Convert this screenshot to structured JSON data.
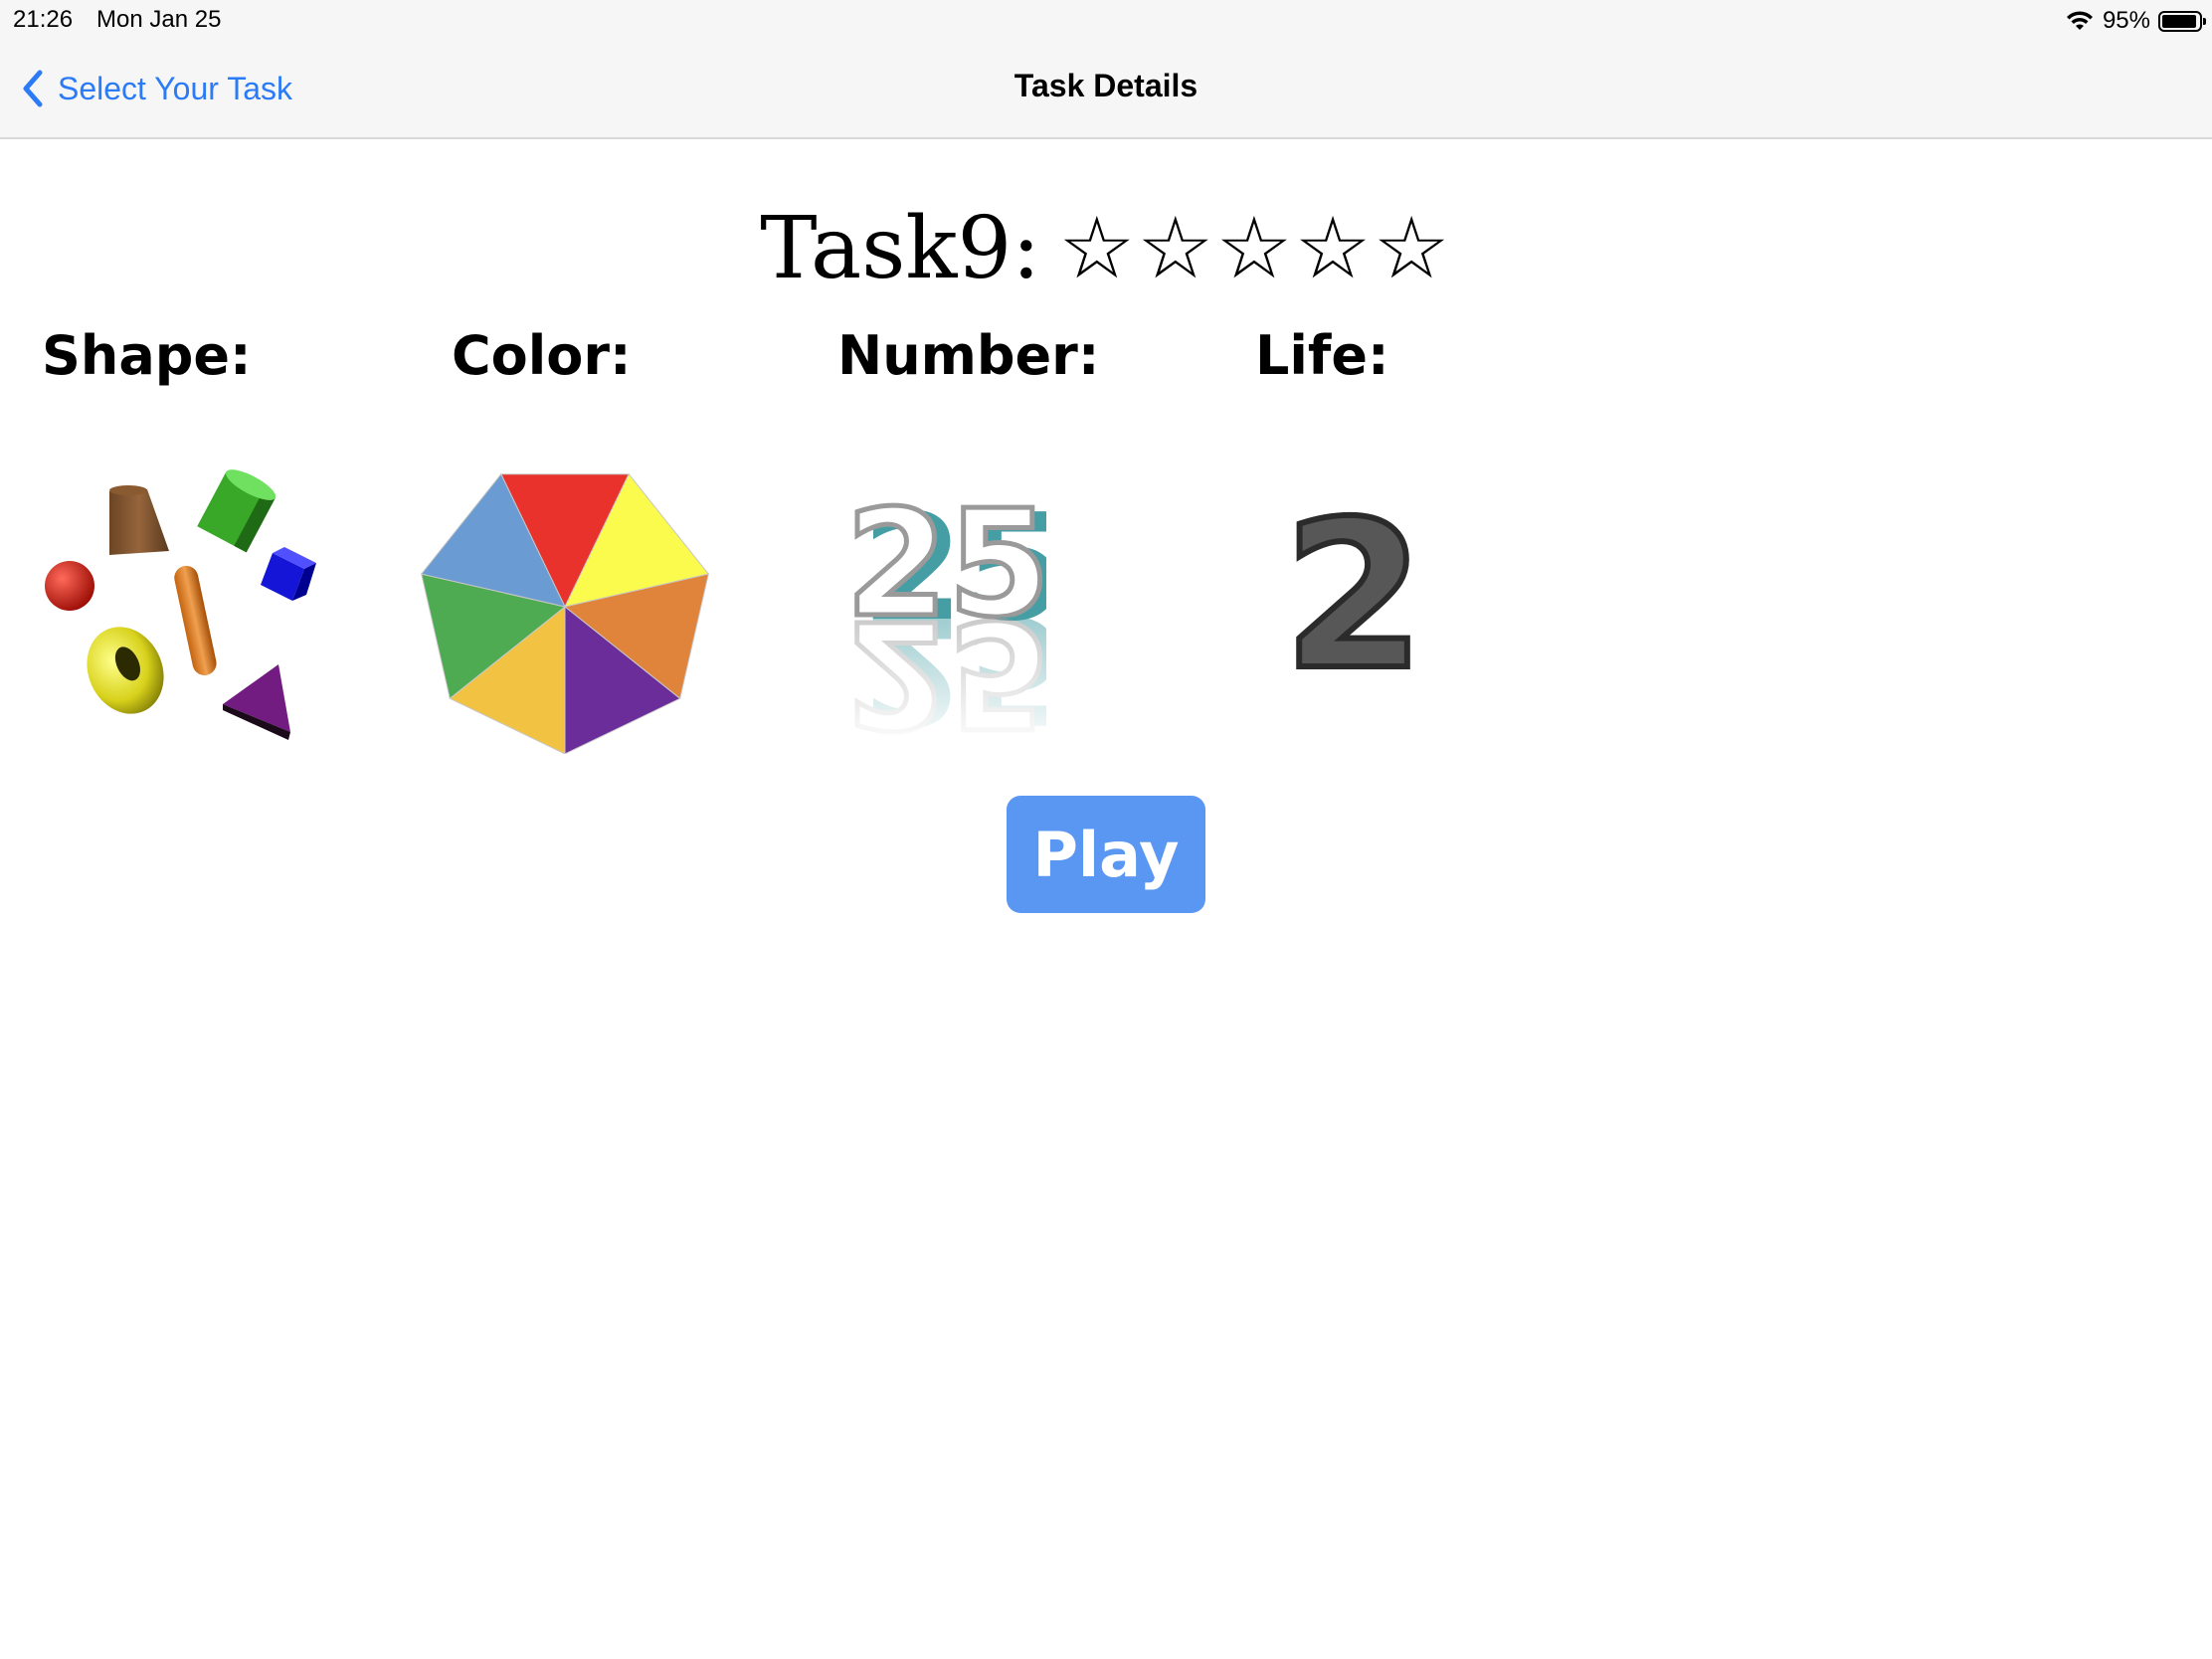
{
  "status_bar": {
    "time": "21:26",
    "date": "Mon Jan 25",
    "battery": "95%",
    "battery_level": 0.95
  },
  "nav": {
    "back_label": "Select Your Task",
    "title": "Task Details"
  },
  "task": {
    "name": "Task9:",
    "stars": "☆☆☆☆☆",
    "rating": 0,
    "max_rating": 5
  },
  "labels": {
    "shape": "Shape:",
    "color": "Color:",
    "number": "Number:",
    "life": "Life:"
  },
  "number_value": "25",
  "life_value": "2",
  "play_label": "Play",
  "colors": {
    "accent": "#2c7bf6",
    "play_button": "#5a97f2",
    "wheel": [
      "#e8322b",
      "#fbfb4e",
      "#e0833b",
      "#6a2d99",
      "#f2c343",
      "#4fab52",
      "#6a9bd2"
    ]
  },
  "icons": {
    "shape": "3d-shapes-icon",
    "color": "color-wheel-icon",
    "number": "number-25-icon",
    "life": "number-2-icon"
  }
}
